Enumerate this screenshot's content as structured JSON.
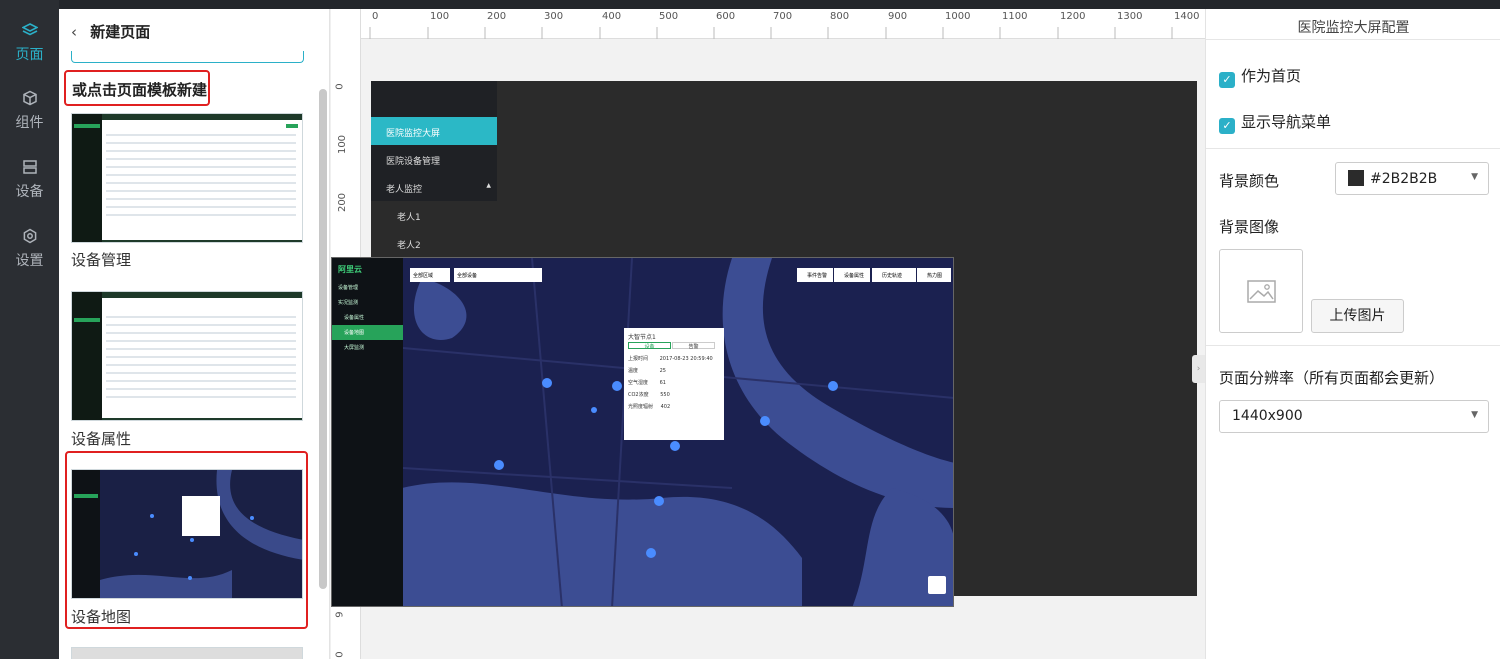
{
  "rail": {
    "items": [
      {
        "label": "页面",
        "icon": "layers-icon"
      },
      {
        "label": "组件",
        "icon": "cube-icon"
      },
      {
        "label": "设备",
        "icon": "device-icon"
      },
      {
        "label": "设置",
        "icon": "gear-icon"
      }
    ]
  },
  "panel": {
    "title": "新建页面",
    "or_template_label": "或点击页面模板新建",
    "templates": [
      {
        "label": "设备管理"
      },
      {
        "label": "设备属性"
      },
      {
        "label": "设备地图"
      }
    ]
  },
  "canvas": {
    "ruler_h": [
      "0",
      "100",
      "200",
      "300",
      "400",
      "500",
      "600",
      "700",
      "800",
      "900",
      "1000",
      "1100",
      "1200",
      "1300",
      "1400"
    ],
    "ruler_v": [
      "0",
      "100",
      "200",
      "9",
      "0"
    ],
    "nav_items": [
      "医院监控大屏",
      "医院设备管理",
      "老人监控",
      "老人1",
      "老人2"
    ],
    "map": {
      "logo": "阿里云",
      "side_items": [
        "设备管理",
        "实况监测",
        "设备属性",
        "设备地图",
        "大屏监测"
      ],
      "filter_1": "全部区域",
      "filter_2": "全部设备",
      "buttons": [
        "事件告警",
        "设备属性",
        "历史轨迹",
        "热力图"
      ],
      "popup_title": "大智节点1",
      "popup_tabs": [
        "设备",
        "告警"
      ],
      "popup_rows": [
        {
          "k": "上报时间",
          "v": "2017-08-23 20:59:40"
        },
        {
          "k": "温度",
          "v": "25"
        },
        {
          "k": "空气湿度",
          "v": "61"
        },
        {
          "k": "CO2浓度",
          "v": "550"
        },
        {
          "k": "光照度辐射",
          "v": "402"
        }
      ]
    }
  },
  "config": {
    "title": "医院监控大屏配置",
    "set_home": "作为首页",
    "show_nav": "显示导航菜单",
    "bg_color_label": "背景颜色",
    "bg_color_value": "#2B2B2B",
    "bg_image_label": "背景图像",
    "upload_button": "上传图片",
    "resolution_label": "页面分辨率（所有页面都会更新）",
    "resolution_value": "1440x900"
  }
}
